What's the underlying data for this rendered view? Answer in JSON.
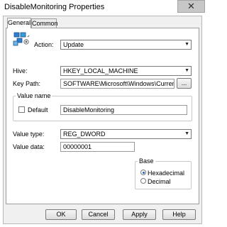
{
  "window": {
    "title": "DisableMonitoring Properties",
    "close_symbol": "✕"
  },
  "tabs": [
    {
      "label": "General"
    },
    {
      "label": "Common"
    }
  ],
  "general": {
    "action_label": "Action:",
    "action_value": "Update",
    "hive_label": "Hive:",
    "hive_value": "HKEY_LOCAL_MACHINE",
    "key_path_label": "Key Path:",
    "key_path_value": "SOFTWARE\\Microsoft\\Windows\\CurrentVersio",
    "browse_label": "...",
    "value_name_group": "Value name",
    "default_label": "Default",
    "default_checked": false,
    "value_name": "DisableMonitoring",
    "value_type_label": "Value type:",
    "value_type": "REG_DWORD",
    "value_data_label": "Value data:",
    "value_data": "00000001",
    "base_group": "Base",
    "base_options": [
      {
        "label": "Hexadecimal",
        "selected": true
      },
      {
        "label": "Decimal",
        "selected": false
      }
    ]
  },
  "buttons": {
    "ok": "OK",
    "cancel": "Cancel",
    "apply": "Apply",
    "help": "Help"
  }
}
